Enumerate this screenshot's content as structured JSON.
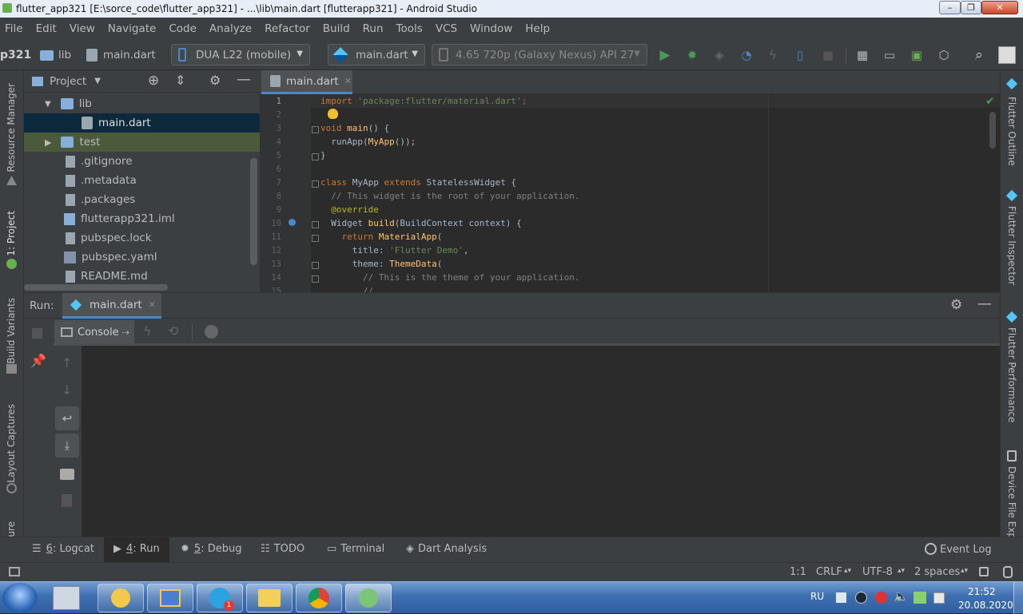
{
  "window": {
    "title": "flutter_app321 [E:\\sorce_code\\flutter_app321] - ...\\lib\\main.dart [flutterapp321] - Android Studio",
    "minimize": "–",
    "maximize": "❐",
    "close": "✕"
  },
  "menu": [
    "File",
    "Edit",
    "View",
    "Navigate",
    "Code",
    "Analyze",
    "Refactor",
    "Build",
    "Run",
    "Tools",
    "VCS",
    "Window",
    "Help"
  ],
  "toolbar": {
    "breadcrumb_project": "p321",
    "breadcrumb_folder": "lib",
    "breadcrumb_file": "main.dart",
    "device": "DUA L22 (mobile)",
    "run_config": "main.dart",
    "avd": "4.65  720p (Galaxy Nexus) API 27"
  },
  "left_strip": {
    "resource_manager": "Resource Manager",
    "project": "1: Project",
    "build_variants": "Build Variants",
    "layout_captures": "Layout Captures",
    "structure": "ure"
  },
  "right_strip": {
    "flutter_outline": "Flutter Outline",
    "flutter_inspector": "Flutter Inspector",
    "flutter_performance": "Flutter Performance",
    "device_file_explorer": "Device File Expl"
  },
  "project_panel": {
    "title": "Project",
    "tree": [
      {
        "label": "lib",
        "type": "folder"
      },
      {
        "label": "main.dart",
        "type": "dart"
      },
      {
        "label": "test",
        "type": "folder"
      },
      {
        "label": ".gitignore",
        "type": "file"
      },
      {
        "label": ".metadata",
        "type": "file"
      },
      {
        "label": ".packages",
        "type": "file"
      },
      {
        "label": "flutterapp321.iml",
        "type": "iml"
      },
      {
        "label": "pubspec.lock",
        "type": "file"
      },
      {
        "label": "pubspec.yaml",
        "type": "yaml"
      },
      {
        "label": "README.md",
        "type": "md"
      }
    ]
  },
  "editor": {
    "tab": "main.dart",
    "line_numbers": [
      "1",
      "2",
      "3",
      "4",
      "5",
      "6",
      "7",
      "8",
      "9",
      "10",
      "11",
      "12",
      "13",
      "14",
      "15"
    ],
    "code": {
      "l1_kw": "import",
      "l1_str": " 'package:flutter/material.dart';",
      "l3_kw": "void",
      "l3_fn": " main",
      "l3_rest": "() {",
      "l4_a": "  runApp(",
      "l4_fn": "MyApp",
      "l4_b": "());",
      "l5": "}",
      "l7_kw": "class",
      "l7_a": " MyApp ",
      "l7_kw2": "extends",
      "l7_b": " StatelessWidget {",
      "l8": "  // This widget is the root of your application.",
      "l9": "  @override",
      "l10_a": "  Widget ",
      "l10_fn": "build",
      "l10_b": "(BuildContext context) {",
      "l11_kw": "    return",
      "l11_fn": " MaterialApp",
      "l11_b": "(",
      "l12_a": "      title: ",
      "l12_str": "'Flutter Demo'",
      "l12_b": ",",
      "l13_a": "      theme: ",
      "l13_fn": "ThemeData",
      "l13_b": "(",
      "l14": "        // This is the theme of your application.",
      "l15": "        //"
    }
  },
  "run_panel": {
    "label": "Run:",
    "tab": "main.dart",
    "console_tab": "Console"
  },
  "bottom_tabs": [
    {
      "num": "6",
      "label": ": Logcat"
    },
    {
      "num": "4",
      "label": ": Run"
    },
    {
      "num": "5",
      "label": ": Debug"
    },
    {
      "num": "",
      "label": "TODO"
    },
    {
      "num": "",
      "label": "Terminal"
    },
    {
      "num": "",
      "label": "Dart Analysis"
    }
  ],
  "event_log": "Event Log",
  "status": {
    "position": "1:1",
    "line_sep": "CRLF",
    "encoding": "UTF-8",
    "indent": "2 spaces"
  },
  "taskbar": {
    "lang": "RU",
    "time": "21:52",
    "date": "20.08.2020",
    "telegram_badge": "1"
  },
  "colors": {
    "accent": "#4a88c7",
    "run_green": "#499c54",
    "keyword": "#cc7832",
    "string": "#6a8759",
    "comment": "#808080",
    "function": "#ffc66d"
  }
}
